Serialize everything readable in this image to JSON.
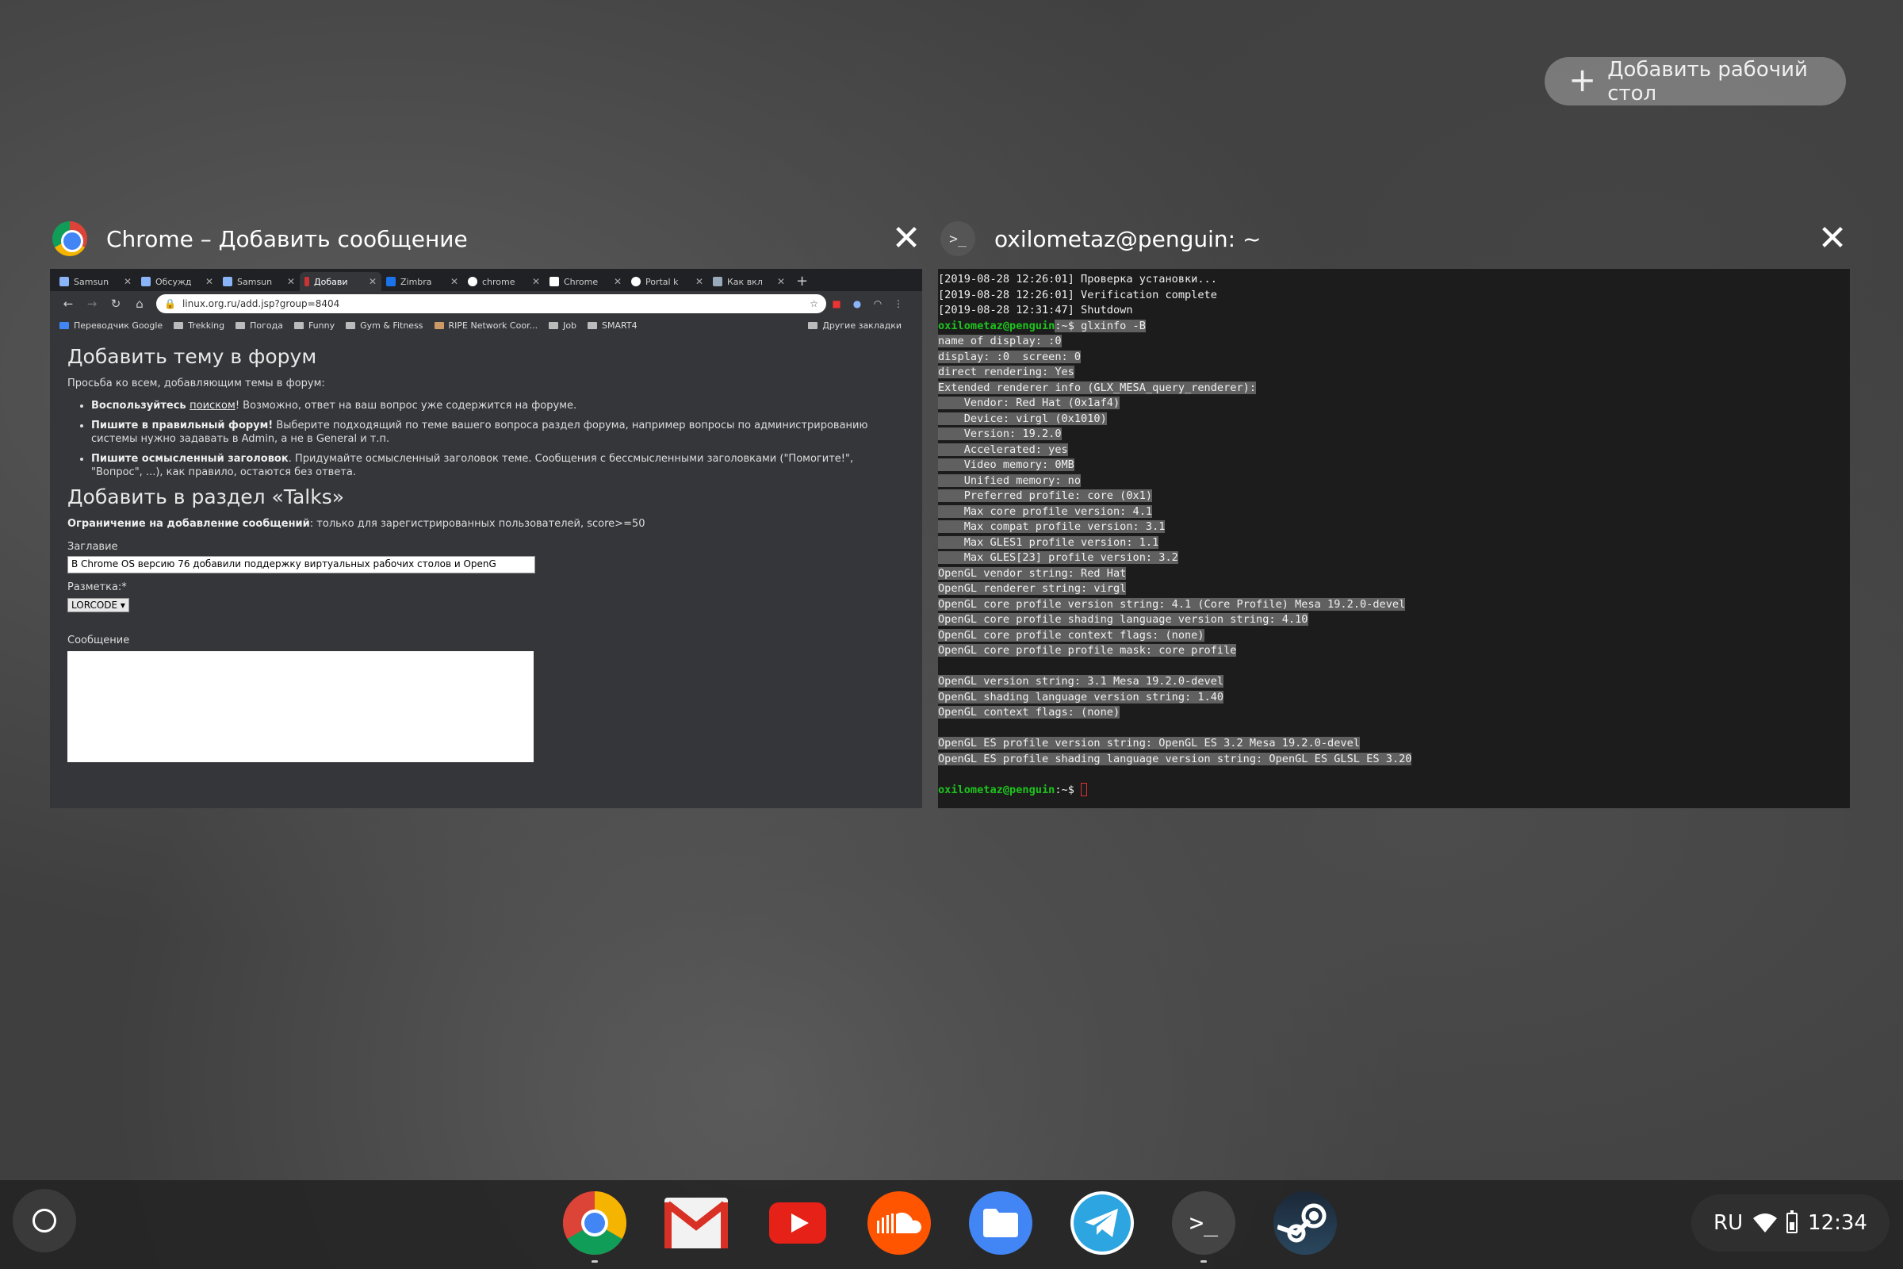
{
  "overview": {
    "add_desk_label": "Добавить рабочий стол"
  },
  "chrome_window": {
    "title": "Chrome – Добавить сообщение",
    "tabs": [
      {
        "label": "Samsun"
      },
      {
        "label": "Обсужд"
      },
      {
        "label": "Samsun"
      },
      {
        "label": "Добави"
      },
      {
        "label": "Zimbra"
      },
      {
        "label": "chrome"
      },
      {
        "label": "Chrome"
      },
      {
        "label": "Portal k"
      },
      {
        "label": "Как вкл"
      }
    ],
    "url": "linux.org.ru/add.jsp?group=8404",
    "bookmarks": [
      "Переводчик Google",
      "Trekking",
      "Погода",
      "Funny",
      "Gym & Fitness",
      "RIPE Network Coor...",
      "Job",
      "SMART4"
    ],
    "other_bookmarks": "Другие закладки",
    "page": {
      "heading1": "Добавить тему в форум",
      "intro": "Просьба ко всем, добавляющим темы в форум:",
      "rule1_bold_a": "Воспользуйтесь ",
      "rule1_link": "поиском",
      "rule1_rest": "! Возможно, ответ на ваш вопрос уже содержится на форуме.",
      "rule2_bold": "Пишите в правильный форум!",
      "rule2_rest": " Выберите подходящий по теме вашего вопроса раздел форума, например вопросы по администрированию системы нужно задавать в Admin, а не в General и т.п.",
      "rule3_bold": "Пишите осмысленный заголовок",
      "rule3_rest": ". Придумайте осмысленный заголовок теме. Сообщения с бессмысленными заголовками (\"Помогите!\", \"Вопрос\", ...), как правило, остаются без ответа.",
      "heading2": "Добавить в раздел «Talks»",
      "restriction_bold": "Ограничение на добавление сообщений",
      "restriction_rest": ": только для зарегистрированных пользователей, score>=50",
      "title_label": "Заглавие",
      "title_value": "В Chrome OS  версию 76 добавили поддержку виртуальных  рабочих столов и OpenG",
      "markup_label": "Разметка:*",
      "markup_value": "LORCODE",
      "message_label": "Сообщение"
    }
  },
  "terminal_window": {
    "title": "oxilometaz@penguin: ~",
    "prompt": "oxilometaz@penguin",
    "prompt_suffix": ":~$ ",
    "command": "glxinfo -B",
    "lines_before": [
      "[2019-08-28 12:26:01] Проверка установки...",
      "[2019-08-28 12:26:01] Verification complete",
      "[2019-08-28 12:31:47] Shutdown"
    ],
    "output": [
      "name of display: :0",
      "display: :0  screen: 0",
      "direct rendering: Yes",
      "Extended renderer info (GLX_MESA_query_renderer):",
      "    Vendor: Red Hat (0x1af4)",
      "    Device: virgl (0x1010)",
      "    Version: 19.2.0",
      "    Accelerated: yes",
      "    Video memory: 0MB",
      "    Unified memory: no",
      "    Preferred profile: core (0x1)",
      "    Max core profile version: 4.1",
      "    Max compat profile version: 3.1",
      "    Max GLES1 profile version: 1.1",
      "    Max GLES[23] profile version: 3.2",
      "OpenGL vendor string: Red Hat",
      "OpenGL renderer string: virgl",
      "OpenGL core profile version string: 4.1 (Core Profile) Mesa 19.2.0-devel",
      "OpenGL core profile shading language version string: 4.10",
      "OpenGL core profile context flags: (none)",
      "OpenGL core profile profile mask: core profile",
      "",
      "OpenGL version string: 3.1 Mesa 19.2.0-devel",
      "OpenGL shading language version string: 1.40",
      "OpenGL context flags: (none)",
      "",
      "OpenGL ES profile version string: OpenGL ES 3.2 Mesa 19.2.0-devel",
      "OpenGL ES profile shading language version string: OpenGL ES GLSL ES 3.20",
      ""
    ]
  },
  "shelf": {
    "apps": [
      "chrome-icon",
      "gmail-icon",
      "youtube-icon",
      "soundcloud-icon",
      "files-icon",
      "telegram-icon",
      "terminal-icon",
      "steam-icon"
    ],
    "terminal_glyph": ">_",
    "tray": {
      "ime": "RU",
      "time": "12:34"
    }
  }
}
